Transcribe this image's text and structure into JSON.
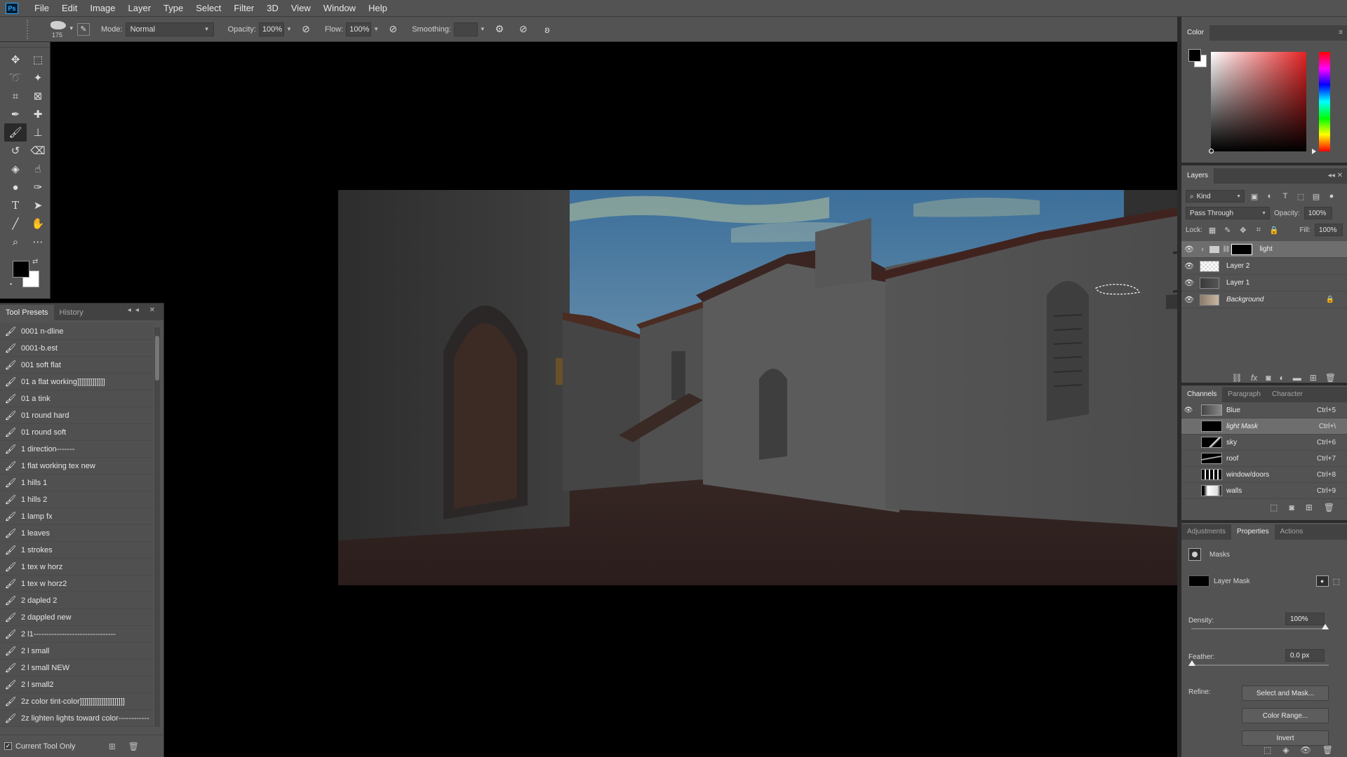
{
  "app": {
    "logo": "Ps"
  },
  "menu": [
    "File",
    "Edit",
    "Image",
    "Layer",
    "Type",
    "Select",
    "Filter",
    "3D",
    "View",
    "Window",
    "Help"
  ],
  "options": {
    "brush_size": "175",
    "mode_label": "Mode:",
    "mode_value": "Normal",
    "opacity_label": "Opacity:",
    "opacity_value": "100%",
    "flow_label": "Flow:",
    "flow_value": "100%",
    "smoothing_label": "Smoothing:",
    "smoothing_value": ""
  },
  "tool_presets": {
    "tabs": [
      "Tool Presets",
      "History"
    ],
    "items": [
      "0001 n-dline",
      "0001-b.est",
      "001 soft flat",
      "01 a flat working]]]]]]]]]]]]]",
      "01 a tink",
      "01 round hard",
      "01 round soft",
      "1 direction-------",
      "1 flat working tex new",
      "1 hills 1",
      "1 hills 2",
      "1 lamp fx",
      "1 leaves",
      "1 strokes",
      "1 tex w horz",
      "1 tex w horz2",
      "2 dapled 2",
      "2 dappled new",
      "2 l1--------------------------------",
      "2 l small",
      "2 l small NEW",
      "2 l small2",
      "2z color tint-color]]]]]]]]]]]]]]]]]]]]]",
      "2z lighten lights toward color------------"
    ],
    "footer_label": "Current Tool Only"
  },
  "color_panel": {
    "title": "Color"
  },
  "layers_panel": {
    "title": "Layers",
    "filter_kind": "Kind",
    "blend_mode": "Pass Through",
    "opacity_label": "Opacity:",
    "opacity_value": "100%",
    "lock_label": "Lock:",
    "fill_label": "Fill:",
    "fill_value": "100%",
    "layers": [
      {
        "name": "light",
        "selected": true
      },
      {
        "name": "Layer 2",
        "selected": false
      },
      {
        "name": "Layer 1",
        "selected": false
      },
      {
        "name": "Background",
        "selected": false
      }
    ]
  },
  "channels_panel": {
    "tabs": [
      "Channels",
      "Paragraph",
      "Character"
    ],
    "channels": [
      {
        "name": "Blue",
        "shortcut": "Ctrl+5"
      },
      {
        "name": "light Mask",
        "shortcut": "Ctrl+\\"
      },
      {
        "name": "sky",
        "shortcut": "Ctrl+6"
      },
      {
        "name": "roof",
        "shortcut": "Ctrl+7"
      },
      {
        "name": "window/doors",
        "shortcut": "Ctrl+8"
      },
      {
        "name": "walls",
        "shortcut": "Ctrl+9"
      }
    ]
  },
  "properties_panel": {
    "tabs": [
      "Adjustments",
      "Properties",
      "Actions"
    ],
    "masks_label": "Masks",
    "layer_mask_label": "Layer Mask",
    "density_label": "Density:",
    "density_value": "100%",
    "feather_label": "Feather:",
    "feather_value": "0.0 px",
    "refine_label": "Refine:",
    "select_and_mask": "Select and Mask...",
    "color_range": "Color Range...",
    "invert": "Invert"
  }
}
